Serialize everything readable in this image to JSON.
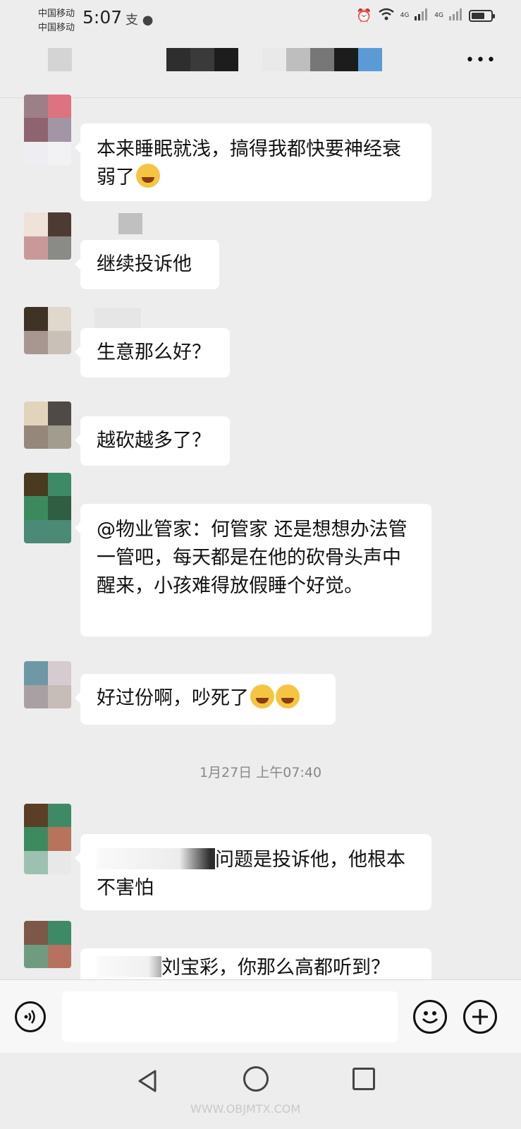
{
  "status_bar": {
    "carrier_1": "中国移动",
    "carrier_2": "中国移动",
    "time": "5:07",
    "notification_icons": "支 ●",
    "signal_1": "4G",
    "signal_2": "4G",
    "battery_fraction": 0.7
  },
  "header": {
    "title": "",
    "more_icon": "more-dots-icon"
  },
  "messages": [
    {
      "text": "本来睡眠就浅，搞得我都快要神经衰弱了",
      "emoji": 1
    },
    {
      "text": "继续投诉他"
    },
    {
      "text": "生意那么好？"
    },
    {
      "text": "越砍越多了？"
    },
    {
      "text": "@物业管家：何管家  还是想想办法管一管吧，每天都是在他的砍骨头声中醒来，小孩难得放假睡个好觉。"
    },
    {
      "text": "好过份啊，吵死了",
      "emoji": 2
    },
    {
      "text": "问题是投诉他，他根本不害怕"
    },
    {
      "text": "刘宝彩，你那么高都听到？"
    }
  ],
  "timestamp": "1月27日 上午07:40",
  "input_bar": {
    "voice_icon": "voice-icon",
    "input_value": "",
    "emoji_icon": "emoji-icon",
    "plus_icon": "plus-icon"
  },
  "nav_bar": {
    "back_icon": "back-triangle-icon",
    "home_icon": "home-circle-icon",
    "recent_icon": "recent-square-icon"
  },
  "watermark": "WWW.OBJMTX.COM",
  "colors": {
    "background": "#ededed",
    "bubble": "#ffffff",
    "timestamp": "#888888"
  }
}
